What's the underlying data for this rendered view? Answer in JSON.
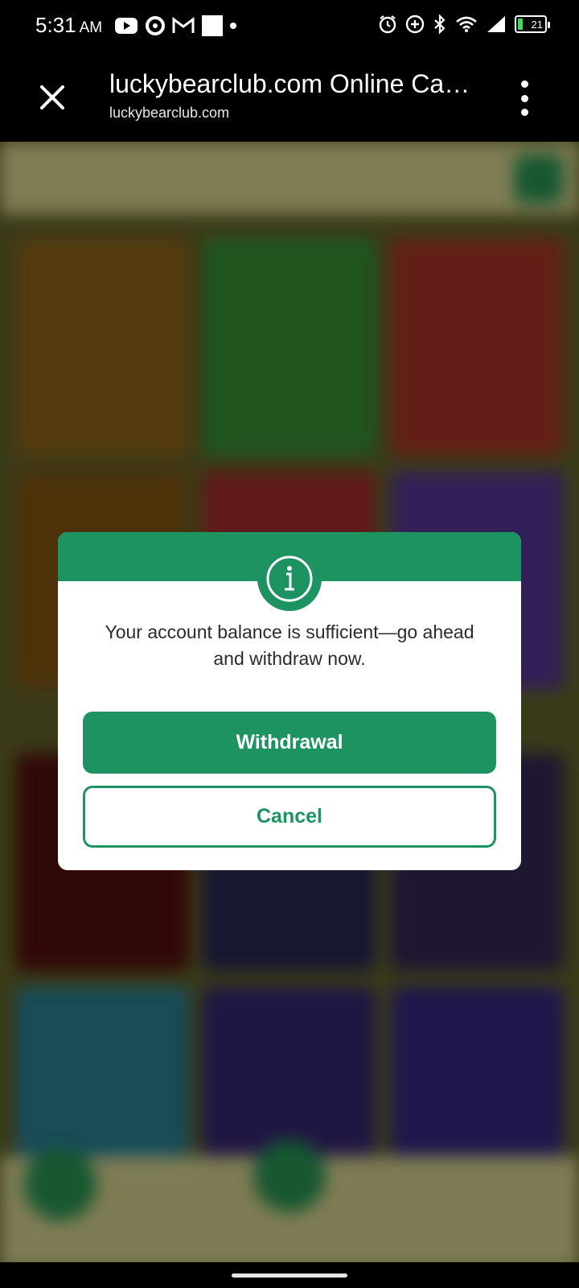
{
  "status_bar": {
    "time": "5:31",
    "ampm": "AM",
    "battery_level": "21"
  },
  "browser": {
    "title": "luckybearclub.com Online Ca…",
    "url": "luckybearclub.com"
  },
  "dialog": {
    "message": "Your account balance is sufficient—go ahead and withdraw now.",
    "primary_label": "Withdrawal",
    "secondary_label": "Cancel"
  },
  "colors": {
    "accent": "#1d9362",
    "toolbar": "#000000"
  }
}
